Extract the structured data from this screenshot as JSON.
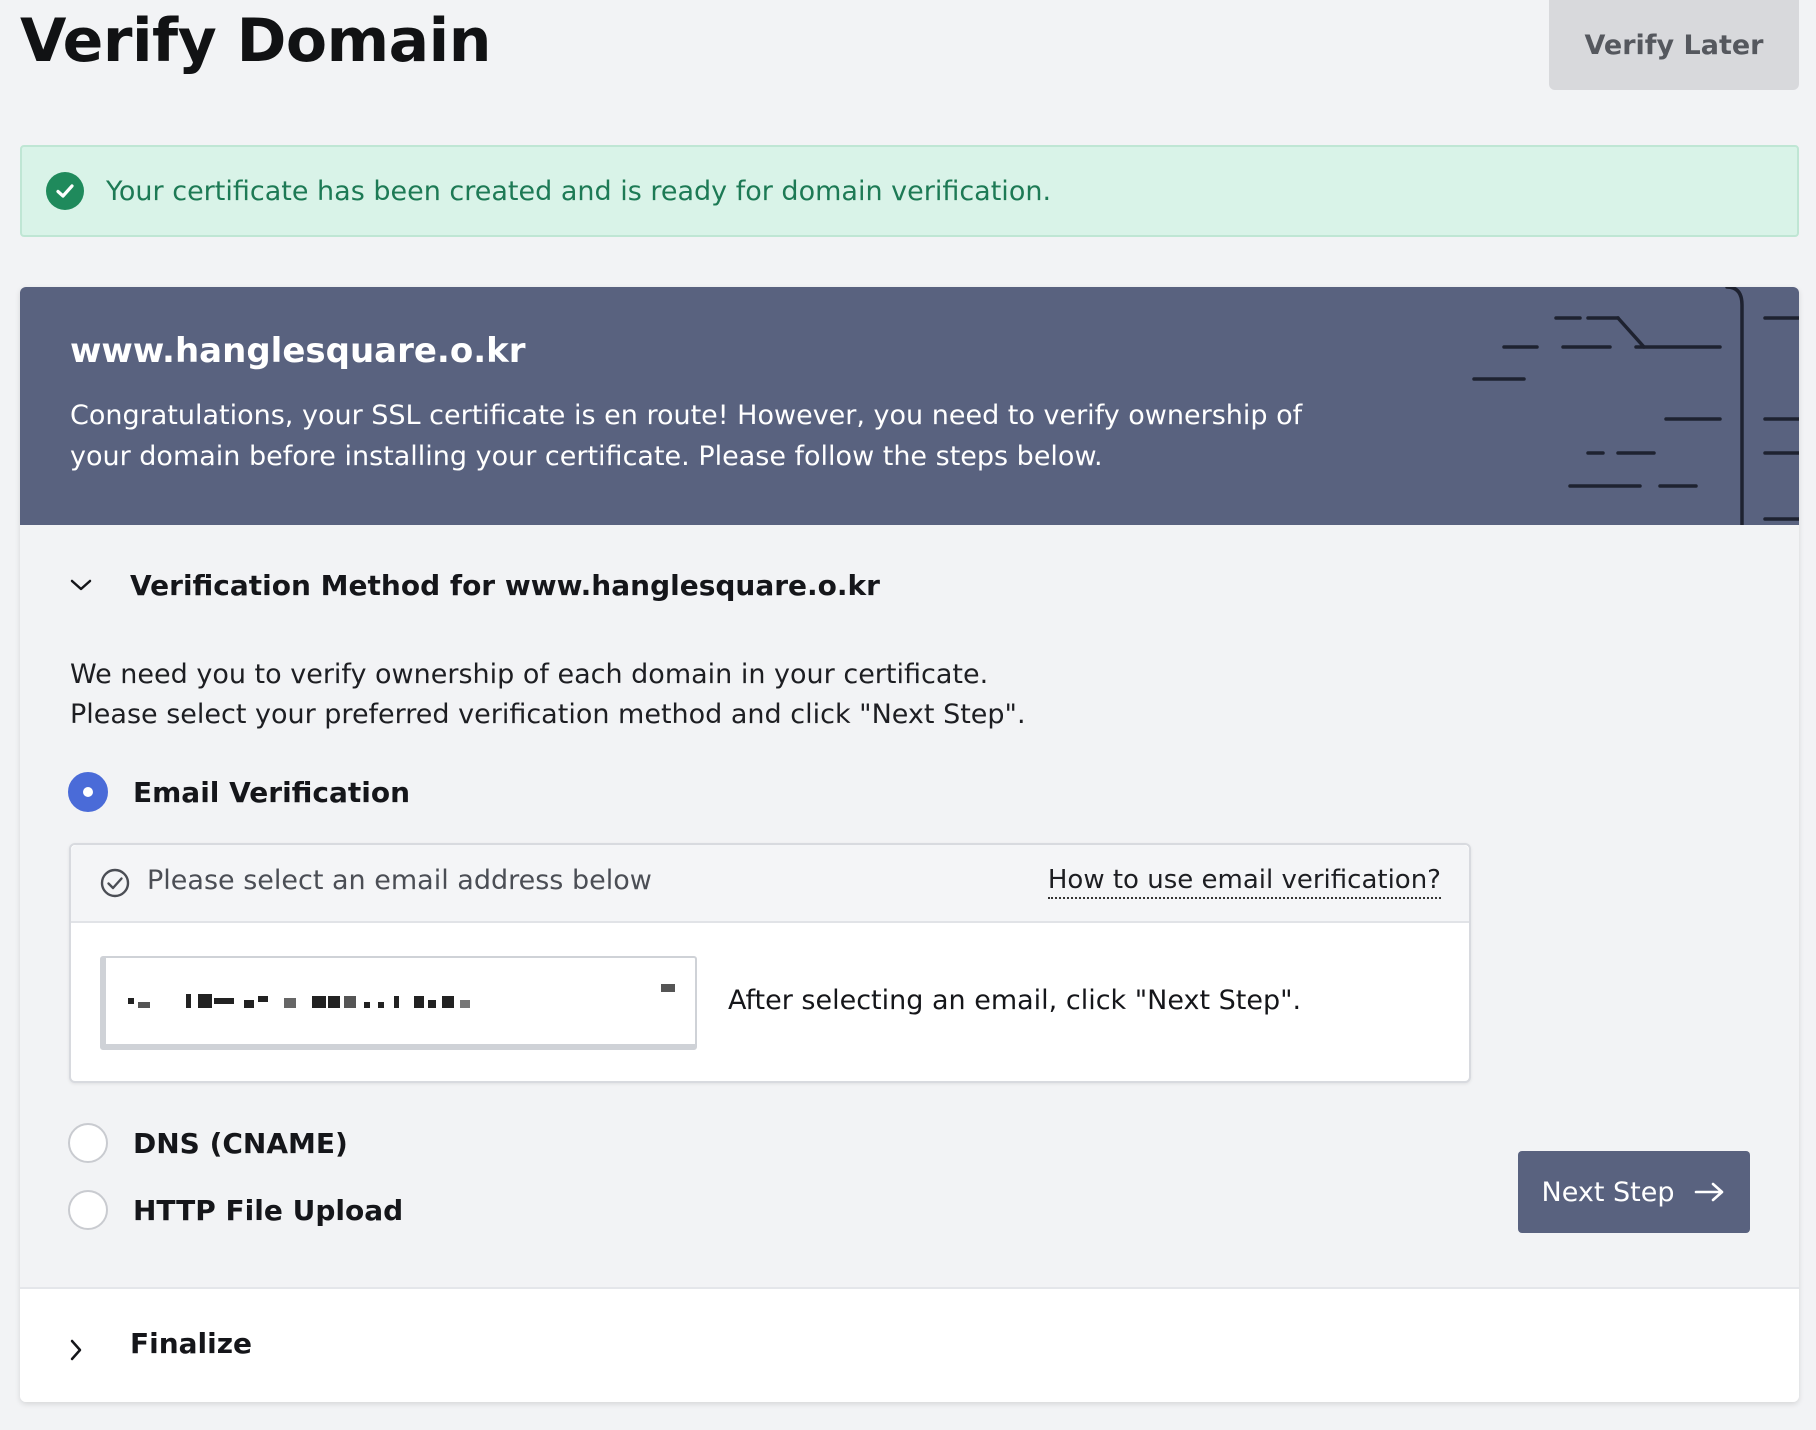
{
  "header": {
    "title": "Verify Domain",
    "verify_later_label": "Verify Later"
  },
  "alert": {
    "icon": "check-circle-icon",
    "message": "Your certificate has been created and is ready for domain verification."
  },
  "hero": {
    "domain": "www.hanglesquare.o.kr",
    "description": "Congratulations, your SSL certificate is en route! However, you need to verify ownership of your domain before installing your certificate. Please follow the steps below."
  },
  "verification": {
    "section_title": "Verification Method for www.hanglesquare.o.kr",
    "intro_line1": "We need you to verify ownership of each domain in your certificate.",
    "intro_line2": "Please select your preferred verification method and click \"Next Step\".",
    "methods": [
      {
        "label": "Email Verification",
        "selected": true
      },
      {
        "label": "DNS (CNAME)",
        "selected": false
      },
      {
        "label": "HTTP File Upload",
        "selected": false
      }
    ],
    "email_panel": {
      "header_text": "Please select an email address below",
      "help_link": "How to use email verification?",
      "hint": "After selecting an email, click \"Next Step\"."
    },
    "next_step_label": "Next Step"
  },
  "finalize": {
    "title": "Finalize"
  },
  "colors": {
    "hero_bg": "#59627f",
    "accent_radio": "#4a6bd8",
    "success_bg": "#d9f3e8",
    "success_text": "#1d7a55"
  }
}
